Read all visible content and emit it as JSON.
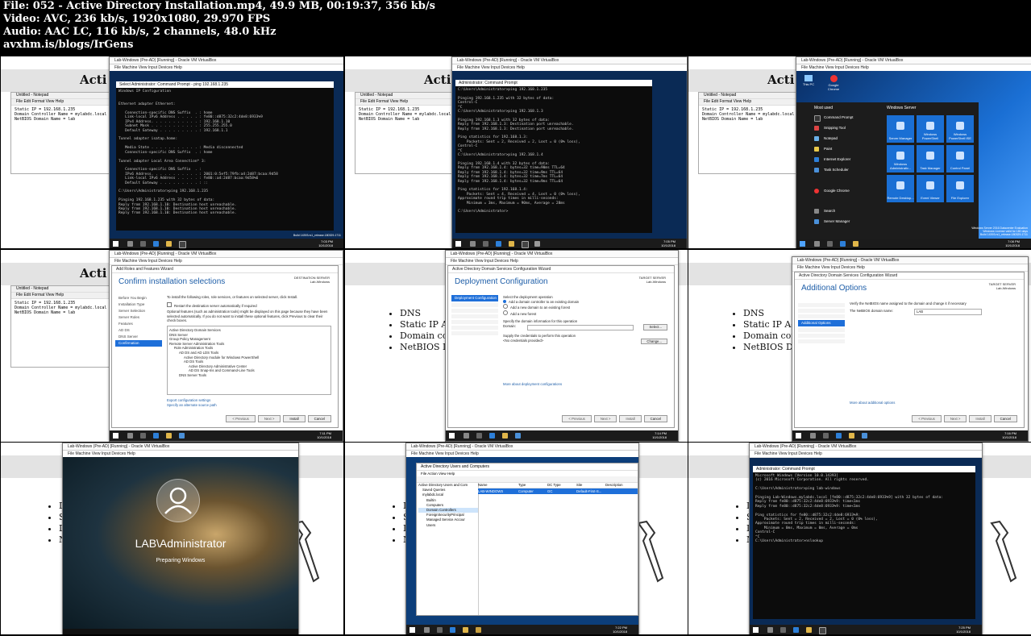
{
  "header": {
    "file_line": "File: 052 - Active Directory Installation.mp4, 49.9 MB, 00:19:37, 356 kb/s",
    "video_line": "Video: AVC, 236 kb/s, 1920x1080, 29.970 FPS",
    "audio_line": "Audio: AAC LC, 116 kb/s, 2 channels, 48.0 kHz",
    "site_line": "avxhm.is/blogs/IrGens"
  },
  "slide": {
    "title_partial": "Acti",
    "bullets": [
      "DNS",
      "Static IP Add",
      "Domain cont",
      "NetBIOS Dom"
    ],
    "bullets_short": [
      "D",
      "S",
      "D",
      "N"
    ]
  },
  "notepad": {
    "title": "Untitled - Notepad",
    "menu": "File  Edit  Format  View  Help",
    "lines": [
      "Static IP = 192.168.1.235",
      "Domain Controller Name = mylabdc.local",
      "NetBIOS Domain Name = lab"
    ]
  },
  "vm_title": "Lab-Windows (Pre-AD) [Running] - Oracle VM VirtualBox",
  "vm_title_b": "Lab-Windows (Pre-AD) [Running] - Oracle VM VirtualBox",
  "vm_menu": "File  Machine  View  Input  Devices  Help",
  "thumbs": {
    "t1": {
      "cmd_title": "Select Administrator: Command Prompt - ping 192.168.1.235",
      "lines": "Windows IP Configuration\n\n\nEthernet adapter Ethernet:\n\n   Connection-specific DNS Suffix  . : home\n   Link-local IPv6 Address . . . . . : fe80::d875:32c2:4de8:6933%9\n   IPv4 Address. . . . . . . . . . . : 192.168.1.10\n   Subnet Mask . . . . . . . . . . . : 255.255.255.0\n   Default Gateway . . . . . . . . . : 192.168.1.1\n\nTunnel adapter isatap.home:\n\n   Media State . . . . . . . . . . . : Media disconnected\n   Connection-specific DNS Suffix  . : home\n\nTunnel adapter Local Area Connection* 3:\n\n   Connection-specific DNS Suffix  . :\n   IPv6 Address. . . . . . . . . . . : 2001:0:5ef5:79fb:a4:2d87:bcaa:9d58\n   Link-local IPv6 Address . . . . . : fe80::a4:2d87:bcaa:9d58%6\n   Default Gateway . . . . . . . . . : ::\n\nC:\\Users\\Administrator>ping 192.168.1.235\n\nPinging 192.168.1.235 with 32 bytes of data:\nReply from 192.168.1.10: Destination host unreachable.\nReply from 192.168.1.10: Destination host unreachable.\nReply from 192.168.1.10: Destination host unreachable.",
      "clock": "7:03 PM\n10/1/2018",
      "build": "Build 14393.rs1_release.180329-1711"
    },
    "t2": {
      "cmd_title": "Administrator: Command Prompt",
      "lines": "C:\\Users\\Administrator>ping 192.168.1.235\n\nPinging 192.168.1.235 with 32 bytes of data:\nControl-C\n^C\nC:\\Users\\Administrator>ping 192.168.1.3\n\nPinging 192.168.1.3 with 32 bytes of data:\nReply from 192.168.1.3: Destination port unreachable.\nReply from 192.168.1.3: Destination port unreachable.\n\nPing statistics for 192.168.1.3:\n    Packets: Sent = 2, Received = 2, Lost = 0 (0% loss),\nControl-C\n^C\nC:\\Users\\Administrator>ping 192.168.1.4\n\nPinging 192.168.1.4 with 32 bytes of data:\nReply from 192.168.1.4: bytes=32 time=90ms TTL=64\nReply from 192.168.1.4: bytes=32 time=9ms TTL=64\nReply from 192.168.1.4: bytes=32 time=7ms TTL=64\nReply from 192.168.1.4: bytes=32 time=9ms TTL=64\n\nPing statistics for 192.168.1.4:\n    Packets: Sent = 4, Received = 4, Lost = 0 (0% loss),\nApproximate round trip times in milli-seconds:\n    Minimum = 3ms, Maximum = 90ms, Average = 28ms\n\nC:\\Users\\Administrator>",
      "clock": "7:05 PM\n10/1/2018"
    },
    "t3": {
      "most_used": "Most used",
      "windows_server": "Windows Server",
      "menu_items": [
        "Command Prompt",
        "Snipping Tool",
        "Notepad",
        "Paint",
        "Internet Explorer",
        "Task Scheduler",
        "Google Chrome",
        "Search",
        "Server Manager"
      ],
      "tiles": [
        "Server Manager",
        "Windows PowerShell",
        "Windows PowerShell ISE",
        "Windows Administrativ...",
        "Task Manager",
        "Control Panel",
        "Remote Desktop...",
        "Event Viewer",
        "File Explorer"
      ],
      "desktop_icons": [
        "This PC",
        "Google Chrome"
      ],
      "eval_text": "Windows Server 2016 Datacenter Evaluation\nWindows License valid for 180 days\nBuild 14393.rs1_release.180329-1711",
      "clock": "7:08 PM\n10/1/2018"
    },
    "t4": {
      "window_title": "Add Roles and Features Wizard",
      "heading": "Confirm installation selections",
      "target": "DESTINATION SERVER\nLab-Windows",
      "nav": [
        "Before You Begin",
        "Installation Type",
        "Server Selection",
        "Server Roles",
        "Features",
        "AD DS",
        "DNS Server",
        "Confirmation"
      ],
      "nav_active": "Confirmation",
      "intro": "To install the following roles, role services, or features on selected server, click Install.",
      "restart": "Restart the destination server automatically if required",
      "optional": "Optional features (such as administration tools) might be displayed on this page because they have been selected automatically. If you do not want to install these optional features, click Previous to clear their check boxes.",
      "features": [
        "Active Directory Domain Services",
        "DNS Server",
        "Group Policy Management",
        "Remote Server Administration Tools",
        "Role Administration Tools",
        "AD DS and AD LDS Tools",
        "Active Directory module for Windows PowerShell",
        "AD DS Tools",
        "Active Directory Administrative Center",
        "AD DS Snap-Ins and Command-Line Tools",
        "DNS Server Tools"
      ],
      "export": "Export configuration settings",
      "alt_source": "Specify an alternate source path",
      "buttons": [
        "< Previous",
        "Next >",
        "Install",
        "Cancel"
      ],
      "clock": "7:11 PM\n10/1/2018"
    },
    "t5": {
      "window_title": "Active Directory Domain Services Configuration Wizard",
      "heading": "Deployment Configuration",
      "target": "TARGET SERVER\nLab-Windows",
      "nav_active": "Deployment Configuration",
      "select_op": "Select the deployment operation",
      "options": [
        "Add a domain controller to an existing domain",
        "Add a new domain to an existing forest",
        "Add a new forest"
      ],
      "specify_domain": "Specify the domain information for this operation",
      "domain_label": "Domain:",
      "select_btn": "Select...",
      "supply": "Supply the credentials to perform this operation",
      "no_creds": "<No credentials provided>",
      "change_btn": "Change...",
      "more": "More about deployment configurations",
      "buttons": [
        "< Previous",
        "Next >",
        "Install",
        "Cancel"
      ],
      "clock": "7:14 PM\n10/1/2018"
    },
    "t6": {
      "window_title": "Active Directory Domain Services Configuration Wizard",
      "heading": "Additional Options",
      "target": "TARGET SERVER\nLab-Windows",
      "nav_active": "Additional Options",
      "verify": "Verify the NetBIOS name assigned to the domain and change it if necessary",
      "netbios_label": "The NetBIOS domain name:",
      "netbios_value": "LAB",
      "more": "More about additional options",
      "buttons": [
        "< Previous",
        "Next >",
        "Install",
        "Cancel"
      ],
      "clock": "7:16 PM\n10/1/2018"
    },
    "t7": {
      "user": "LAB\\Administrator",
      "status": "Preparing Windows"
    },
    "t8": {
      "window_title": "Active Directory Users and Computers",
      "menu": "File  Action  View  Help",
      "tree": [
        "Active Directory Users and Com",
        "Saved Queries",
        "mylabdc.local",
        "Builtin",
        "Computers",
        "Domain Controllers",
        "ForeignSecurityPrincipal",
        "Managed Service Accour",
        "Users"
      ],
      "columns": [
        "Name",
        "Type",
        "DC Type",
        "Site",
        "Description"
      ],
      "row": [
        "LAB-WINDOWS",
        "Computer",
        "GC",
        "Default-First-S...",
        ""
      ],
      "clock": "7:22 PM\n10/1/2018"
    },
    "t9": {
      "cmd_title": "Administrator: Command Prompt",
      "lines": "Microsoft Windows [Version 10.0.14393]\n(c) 2016 Microsoft Corporation. All rights reserved.\n\nC:\\Users\\Administrator>ping lab-windows\n\nPinging Lab-Windows.mylabdc.local [fe80::d875:32c2:4de8:6933%9] with 32 bytes of data:\nReply from fe80::d875:32c2:4de8:6933%9: time<1ms\nReply from fe80::d875:32c2:4de8:6933%9: time<1ms\n\nPing statistics for fe80::d875:32c2:4de8:6933%9:\n    Packets: Sent = 2, Received = 2, Lost = 0 (0% loss),\nApproximate round trip times in milli-seconds:\n    Minimum = 0ms, Maximum = 0ms, Average = 0ms\nControl-C\n^C\nC:\\Users\\Administrator>nslookup",
      "clock": "7:25 PM\n10/1/2018"
    }
  }
}
